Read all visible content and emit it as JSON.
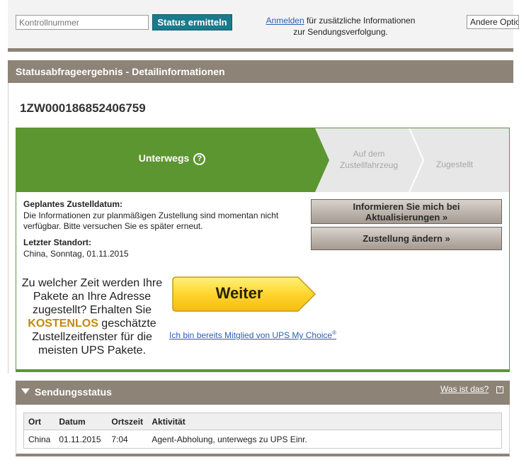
{
  "tracking_bar": {
    "input_placeholder": "Kontrollnummer",
    "status_button": "Status ermitteln",
    "login_link": "Anmelden",
    "login_text_1": " für zusätzliche Informationen",
    "login_text_2": "zur Sendungsverfolgung.",
    "other_options": "Andere Optionen"
  },
  "detail": {
    "header": "Statusabfrageergebnis - Detailinformationen",
    "tracking_number": "1ZW000186852406759"
  },
  "progress": {
    "current_step": "Unterwegs",
    "help_glyph": "?",
    "step_vehicle_line1": "Auf dem",
    "step_vehicle_line2": "Zustellfahrzeug",
    "step_delivered": "Zugestellt",
    "color_active": "#5c9630",
    "color_inactive": "#e7e7e7"
  },
  "delivery": {
    "planned_heading": "Geplantes Zustelldatum:",
    "planned_text": "Die Informationen zur planmäßigen Zustellung sind momentan nicht verfügbar. Bitte versuchen Sie es später erneut.",
    "location_heading": "Letzter Standort:",
    "location_value": "China, Sonntag, 01.11.2015",
    "notify_line1": "Informieren Sie mich bei",
    "notify_line2": "Aktualisierungen »",
    "change_delivery": "Zustellung ändern »"
  },
  "promo": {
    "text_before": "Zu welcher Zeit werden Ihre Pakete an Ihre Adresse zugestellt? Erhalten Sie ",
    "free": "KOSTENLOS",
    "text_after": " geschätzte Zustellzeitfenster für die meisten UPS Pakete.",
    "continue_button": "Weiter",
    "member_link": "Ich bin bereits Mitglied von UPS My Choice",
    "member_mark": "®"
  },
  "shipment_status": {
    "title": "Sendungsstatus",
    "what_is_link": "Was ist das?",
    "columns": [
      "Ort",
      "Datum",
      "Ortszeit",
      "Aktivität"
    ],
    "rows": [
      [
        "China",
        "01.11.2015",
        "7:04",
        "Agent-Abholung, unterwegs zu UPS Einr."
      ]
    ]
  },
  "colors": {
    "brand_brown": "#8d8377",
    "action_teal": "#1b7a8c",
    "link_blue": "#2a5fb3",
    "promo_yellow": "#ffd52e"
  }
}
